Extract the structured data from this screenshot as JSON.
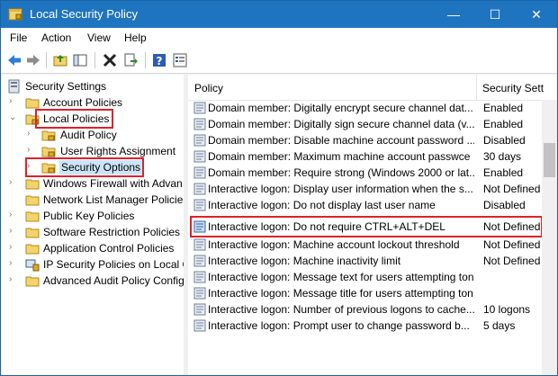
{
  "window": {
    "title": "Local Security Policy",
    "minimize_glyph": "—",
    "maximize_glyph": "☐",
    "close_glyph": "✕"
  },
  "menu": [
    "File",
    "Action",
    "View",
    "Help"
  ],
  "toolbar": {
    "icons": [
      "back-arrow-icon",
      "forward-arrow-icon",
      "up-folder-icon",
      "show-hide-tree-icon",
      "delete-icon",
      "export-list-icon",
      "help-icon",
      "properties-icon"
    ]
  },
  "tree": {
    "root": "Security Settings",
    "items": [
      "Account Policies",
      "Local Policies",
      "Audit Policy",
      "User Rights Assignment",
      "Security Options",
      "Windows Firewall with Advan",
      "Network List Manager Policies",
      "Public Key Policies",
      "Software Restriction Policies",
      "Application Control Policies",
      "IP Security Policies on Local C",
      "Advanced Audit Policy Config"
    ]
  },
  "list": {
    "columns": [
      "Policy",
      "Security Sett"
    ],
    "rows": [
      {
        "policy": "Domain member: Digitally encrypt secure channel dat...",
        "setting": "Enabled"
      },
      {
        "policy": "Domain member: Digitally sign secure channel data (v...",
        "setting": "Enabled"
      },
      {
        "policy": "Domain member: Disable machine account password ...",
        "setting": "Disabled"
      },
      {
        "policy": "Domain member: Maximum machine account passwce",
        "setting": "30 days"
      },
      {
        "policy": "Domain member: Require strong (Windows 2000 or lat...",
        "setting": "Enabled"
      },
      {
        "policy": "Interactive logon: Display user information when the s...",
        "setting": "Not Defined"
      },
      {
        "policy": "Interactive logon: Do not display last user name",
        "setting": "Disabled"
      },
      {
        "policy": "Interactive logon: Do not require CTRL+ALT+DEL",
        "setting": "Not Defined"
      },
      {
        "policy": "Interactive logon: Machine account lockout threshold",
        "setting": "Not Defined"
      },
      {
        "policy": "Interactive logon: Machine inactivity limit",
        "setting": "Not Defined"
      },
      {
        "policy": "Interactive logon: Message text for users attempting ton",
        "setting": ""
      },
      {
        "policy": "Interactive logon: Message title for users attempting ton",
        "setting": ""
      },
      {
        "policy": "Interactive logon: Number of previous logons to cache...",
        "setting": "10 logons"
      },
      {
        "policy": "Interactive logon: Prompt user to change password b...",
        "setting": "5 days"
      }
    ]
  },
  "colors": {
    "titlebar": "#1f74c0",
    "highlight": "#e0202a"
  }
}
